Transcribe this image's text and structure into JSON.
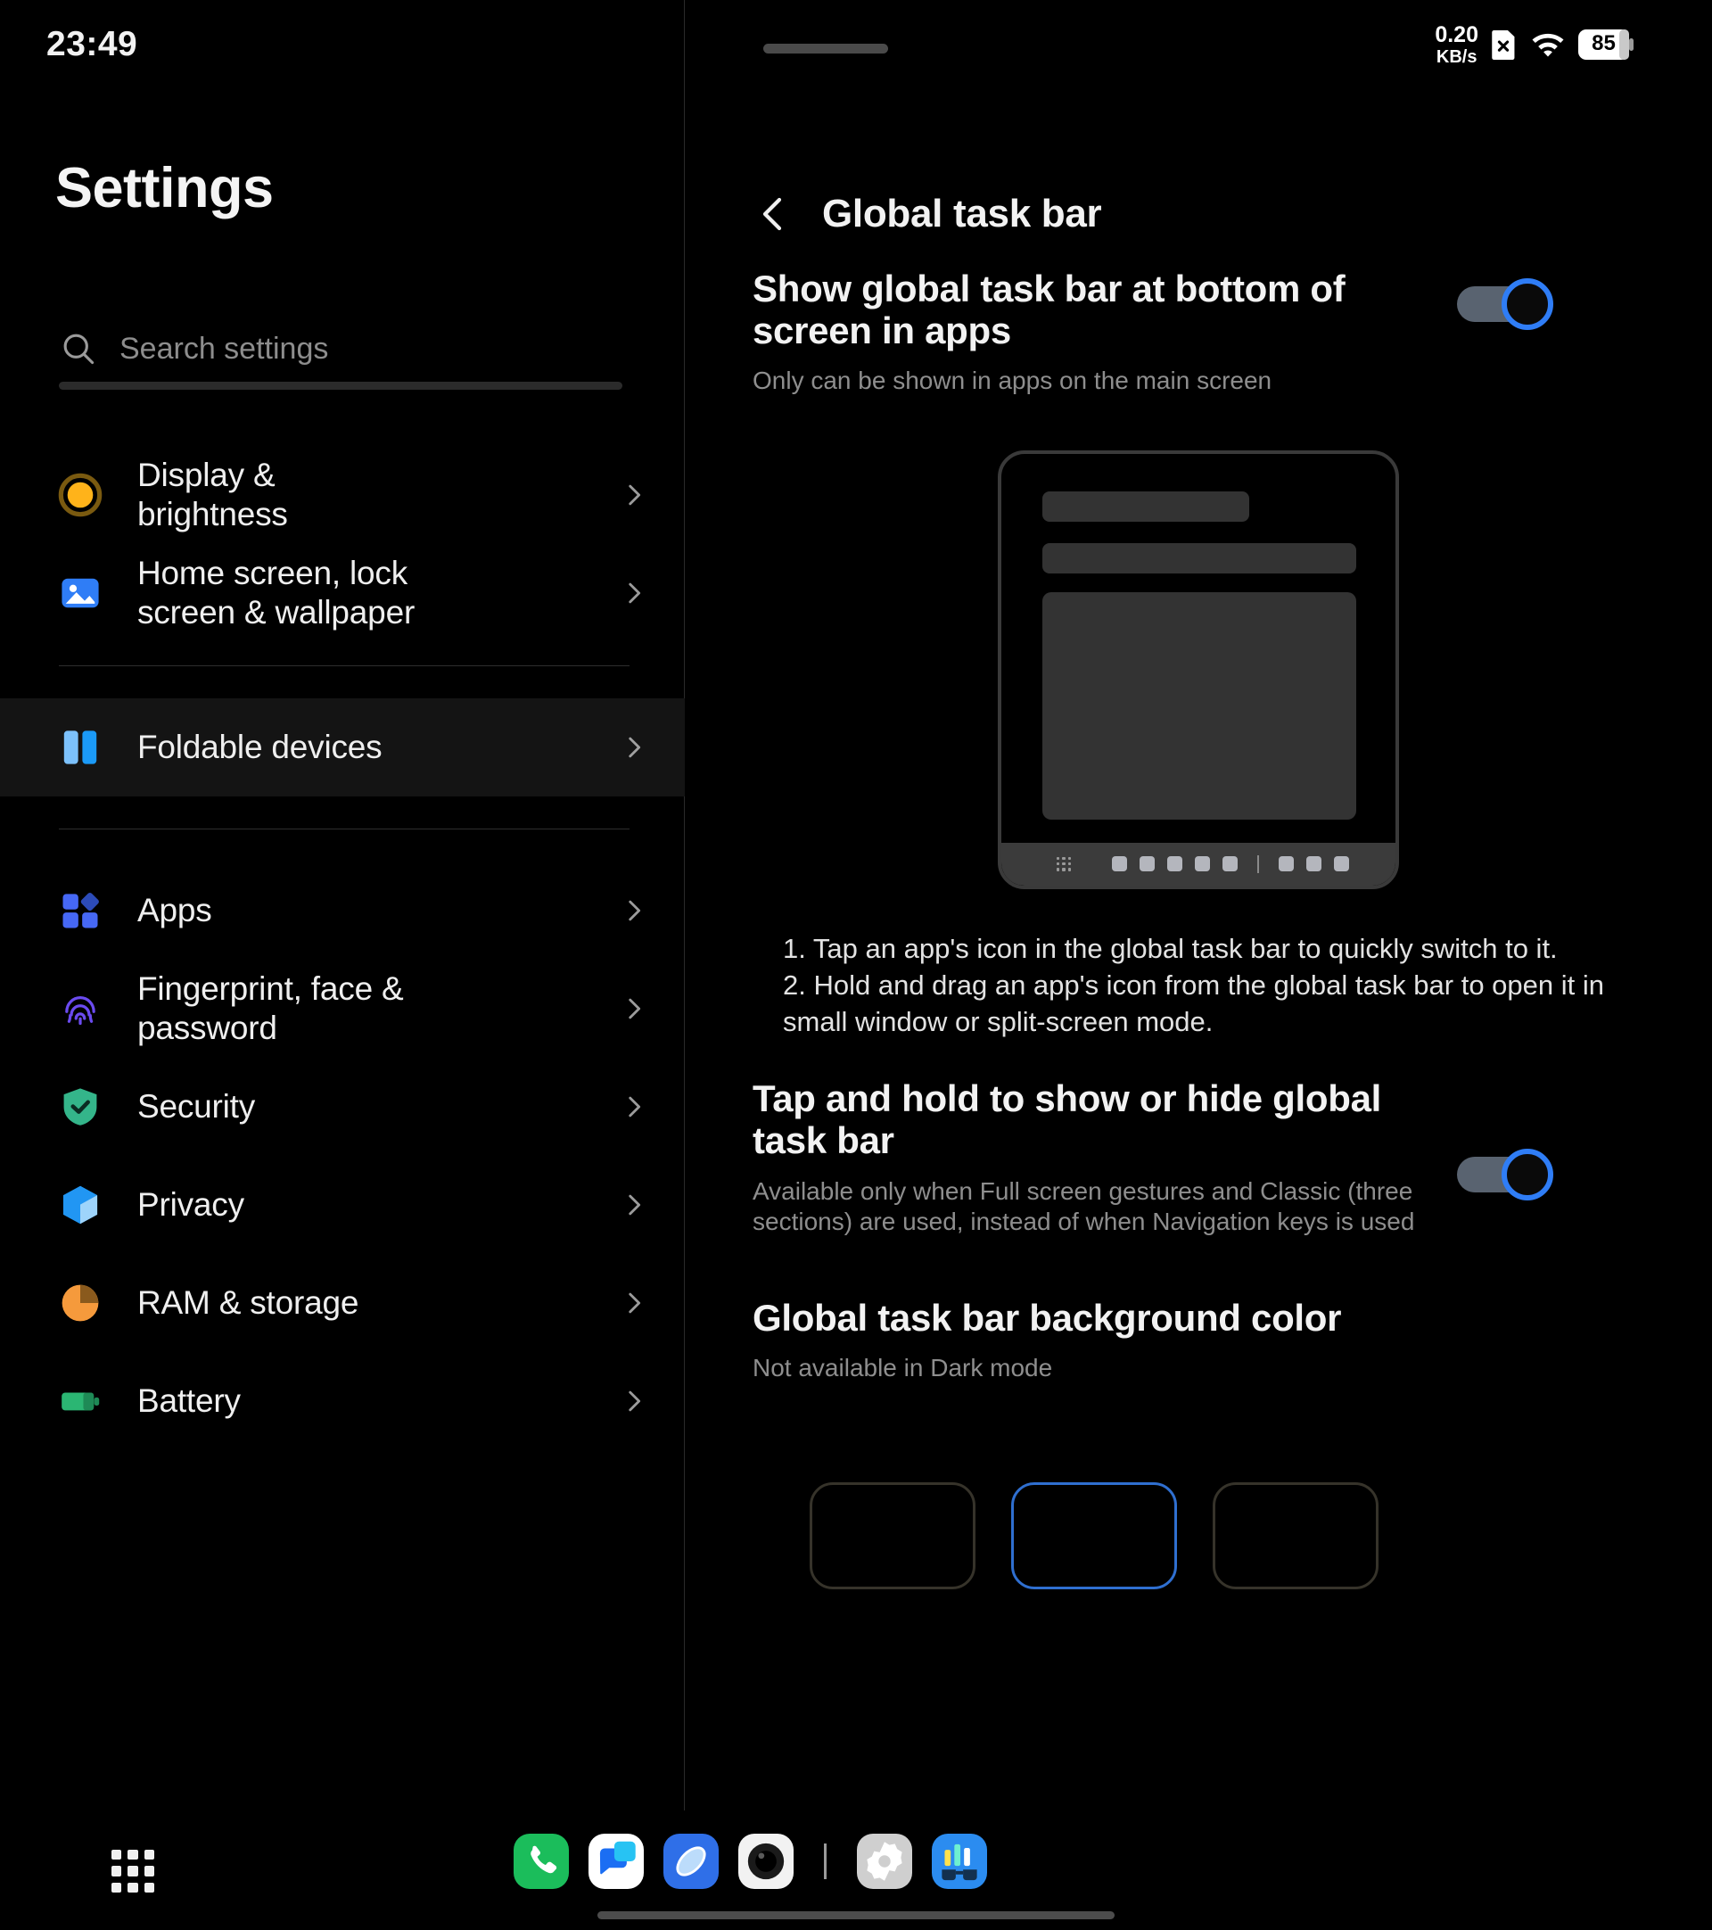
{
  "status_bar": {
    "clock": "23:49",
    "net_speed_value": "0.20",
    "net_speed_unit": "KB/s",
    "sim_icon": "sim-card-off-icon",
    "wifi_icon": "wifi-icon",
    "battery_level": "85"
  },
  "sidebar": {
    "title": "Settings",
    "search": {
      "placeholder": "Search settings",
      "value": "",
      "icon": "search-icon"
    },
    "items": [
      {
        "label": "Display &\nbrightness",
        "icon": "brightness-icon",
        "selected": false,
        "group": 0
      },
      {
        "label": "Home screen, lock\nscreen & wallpaper",
        "icon": "wallpaper-icon",
        "selected": false,
        "group": 0
      },
      {
        "label": "Foldable devices",
        "icon": "foldable-devices-icon",
        "selected": true,
        "group": 1
      },
      {
        "label": "Apps",
        "icon": "apps-icon",
        "selected": false,
        "group": 2
      },
      {
        "label": "Fingerprint, face &\npassword",
        "icon": "fingerprint-icon",
        "selected": false,
        "group": 2
      },
      {
        "label": "Security",
        "icon": "shield-check-icon",
        "selected": false,
        "group": 2
      },
      {
        "label": "Privacy",
        "icon": "privacy-cube-icon",
        "selected": false,
        "group": 2
      },
      {
        "label": "RAM & storage",
        "icon": "pie-chart-icon",
        "selected": false,
        "group": 2
      },
      {
        "label": "Battery",
        "icon": "battery-icon",
        "selected": false,
        "group": 2
      }
    ],
    "chevron_icon": "chevron-right-icon"
  },
  "detail": {
    "back_icon": "chevron-left-icon",
    "title": "Global task bar",
    "settings": [
      {
        "title": "Show global task bar at bottom of screen in apps",
        "subtitle": "Only can be shown in apps on the main screen",
        "toggle": "on"
      },
      {
        "title": "Tap and hold to show or hide global task bar",
        "subtitle": "Available only when Full screen gestures and Classic (three sections) are used, instead of when Navigation keys is used",
        "toggle": "on"
      }
    ],
    "illustration": {
      "name": "foldable-device-taskbar-illustration",
      "taskbar_app_count": 8,
      "drawer_icon": "app-drawer-grid-icon"
    },
    "steps": "1. Tap an app's icon in the global task bar to quickly switch to it.\n2. Hold and drag an app's icon from the global task bar to open it in small window or split-screen mode.",
    "color_section": {
      "title": "Global task bar background color",
      "subtitle": "Not available in Dark mode",
      "swatches": [
        {
          "name": "color-swatch-1",
          "selected": false
        },
        {
          "name": "color-swatch-2",
          "selected": true
        },
        {
          "name": "color-swatch-3",
          "selected": false
        }
      ]
    }
  },
  "dock": {
    "drawer_icon": "app-drawer-grid-icon",
    "apps": [
      {
        "name": "phone-app-icon",
        "color": "#1bbd5b"
      },
      {
        "name": "messages-app-icon",
        "color": "#ffffff"
      },
      {
        "name": "browser-app-icon",
        "color": "#2f6fe8"
      },
      {
        "name": "camera-app-icon",
        "color": "#f2f2f2"
      },
      {
        "name": "settings-app-icon",
        "color": "#cfcfcf"
      },
      {
        "name": "stats-glasses-app-icon",
        "color": "#2b8cf0"
      }
    ],
    "separator": "dock-separator"
  },
  "colors": {
    "accent": "#2f7df6",
    "background": "#000000",
    "selected_row": "#141414",
    "muted_text": "#8e8e8e"
  }
}
